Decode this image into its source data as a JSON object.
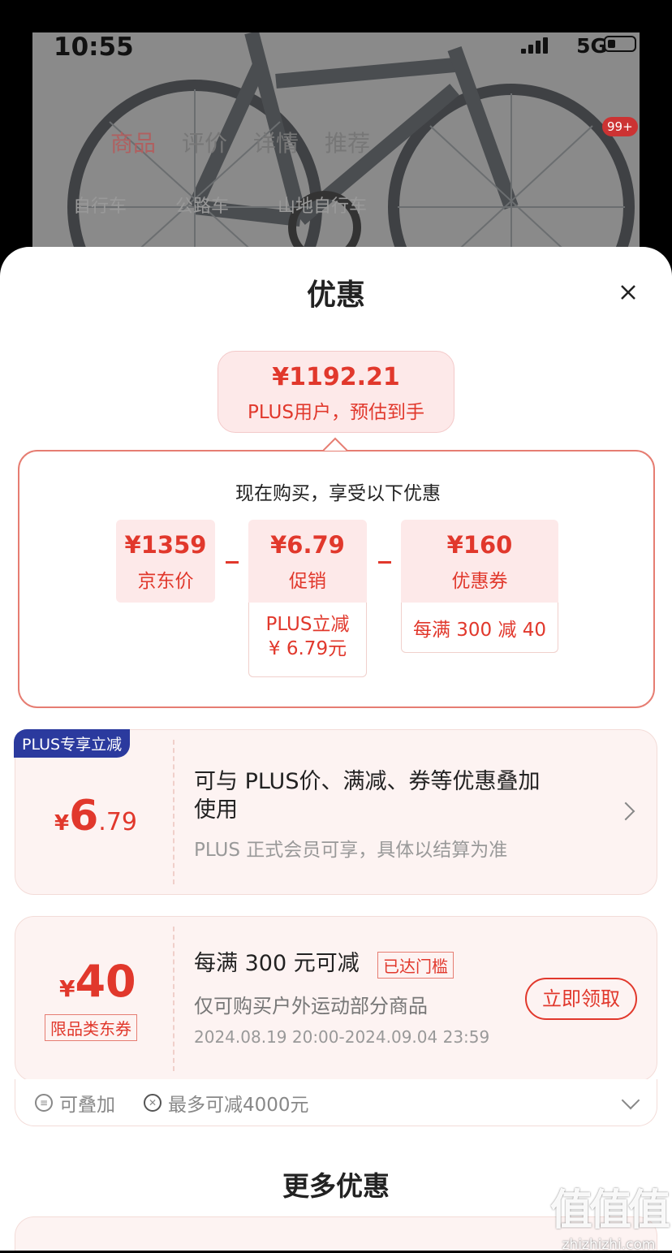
{
  "status_bar": {
    "time": "10:55",
    "network": "5G"
  },
  "background": {
    "tabs": [
      "商品",
      "评价",
      "详情",
      "推荐"
    ],
    "badge": "99+",
    "search_items": [
      "自行车",
      "公路车",
      "山地自行车"
    ]
  },
  "sheet": {
    "title": "优惠"
  },
  "estimate": {
    "price": "¥1192.21",
    "label": "PLUS用户，预估到手"
  },
  "breakdown": {
    "title": "现在购买，享受以下优惠",
    "items": [
      {
        "value": "¥1359",
        "label": "京东价"
      },
      {
        "value": "¥6.79",
        "label": "促销",
        "detail": [
          "PLUS立减",
          "¥ 6.79元"
        ]
      },
      {
        "value": "¥160",
        "label": "优惠券",
        "detail": [
          "每满 300 减 40"
        ]
      }
    ]
  },
  "plus_card": {
    "tag": "PLUS专享立减",
    "amount_symbol": "¥",
    "amount_int": "6",
    "amount_dec": ".79",
    "main_line1": "可与 PLUS价、满减、券等优惠叠加",
    "main_line2": "使用",
    "sub": "PLUS 正式会员可享，具体以结算为准"
  },
  "coupon_card": {
    "amount_symbol": "¥",
    "amount": "40",
    "type_tag": "限品类东券",
    "main": "每满 300 元可减",
    "status_tag": "已达门槛",
    "scope": "仅可购买户外运动部分商品",
    "validity": "2024.08.19 20:00-2024.09.04 23:59",
    "button": "立即领取",
    "stackable": "可叠加",
    "max_discount": "最多可减4000元"
  },
  "more_title": "更多优惠",
  "watermark": {
    "brand": "值值值",
    "url": "zhizhizhi.com"
  },
  "colors": {
    "accent": "#e1382c",
    "plus_blue": "#2b3a9e",
    "pink_bg": "#fde9e9"
  }
}
